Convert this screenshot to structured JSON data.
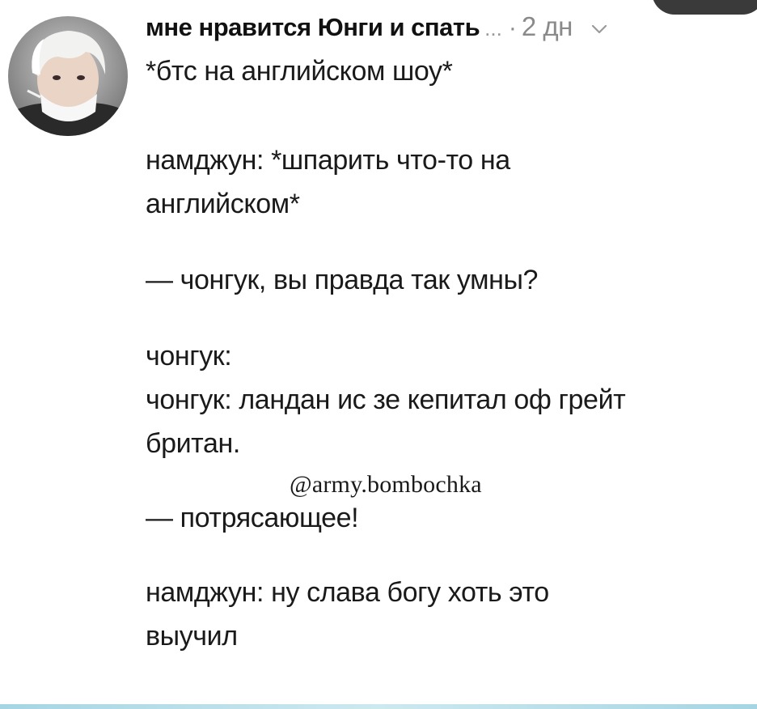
{
  "header": {
    "author_name": "мне нравится Юнги и спать",
    "ellipsis": "...",
    "separator": "·",
    "timestamp": "2 дн"
  },
  "avatar": {
    "icon": "user-avatar-photo"
  },
  "post": {
    "lines": [
      "*бтс на английском шоу*",
      "",
      "намджун: *шпарить что-то на",
      "английском*",
      "",
      "— чонгук, вы правда так умны?",
      "",
      "чонгук:",
      "чонгук: ландан ис зе кепитал оф грейт",
      "британ.",
      "",
      "— потрясающее!",
      "",
      "намджун: ну слава богу хоть это",
      "выучил"
    ]
  },
  "watermark": "@army.bombochka",
  "colors": {
    "text": "#1a1a1a",
    "muted": "#8a8a8a",
    "background": "#ffffff"
  }
}
